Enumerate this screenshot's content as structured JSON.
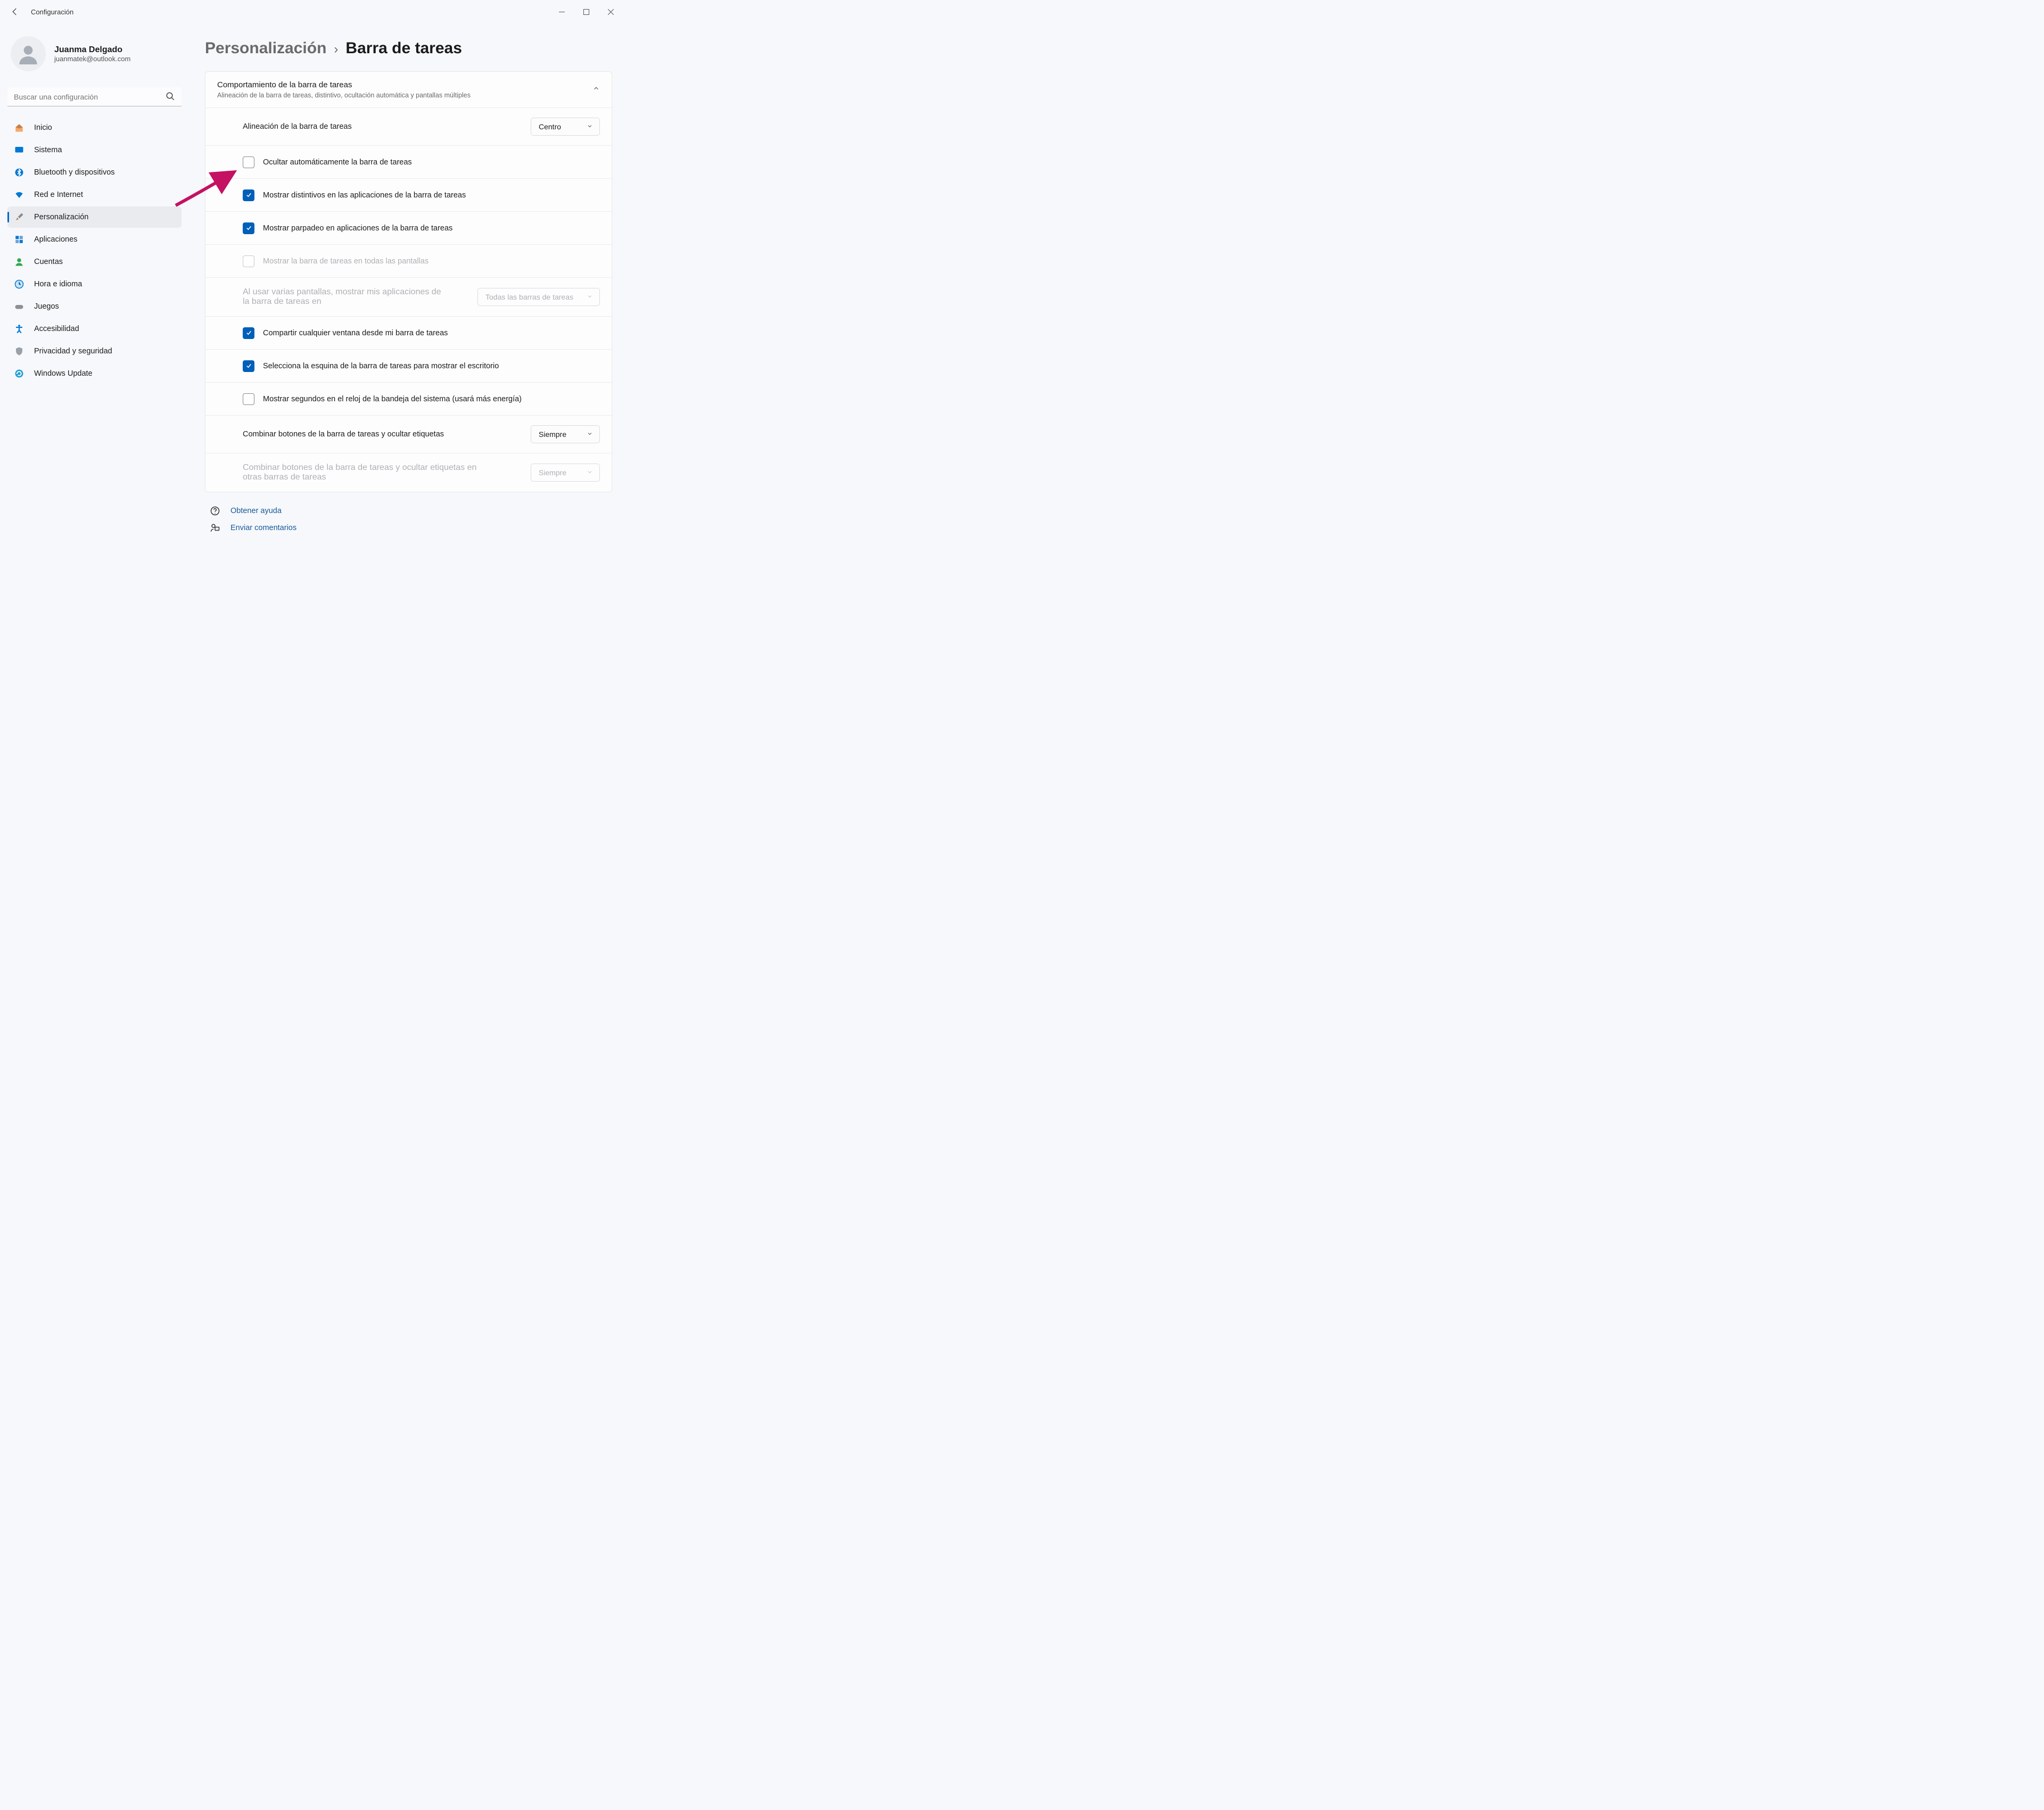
{
  "app_title": "Configuración",
  "profile": {
    "name": "Juanma Delgado",
    "email": "juanmatek@outlook.com"
  },
  "search": {
    "placeholder": "Buscar una configuración"
  },
  "nav": {
    "items": [
      {
        "label": "Inicio"
      },
      {
        "label": "Sistema"
      },
      {
        "label": "Bluetooth y dispositivos"
      },
      {
        "label": "Red e Internet"
      },
      {
        "label": "Personalización"
      },
      {
        "label": "Aplicaciones"
      },
      {
        "label": "Cuentas"
      },
      {
        "label": "Hora e idioma"
      },
      {
        "label": "Juegos"
      },
      {
        "label": "Accesibilidad"
      },
      {
        "label": "Privacidad y seguridad"
      },
      {
        "label": "Windows Update"
      }
    ],
    "selected_index": 4
  },
  "breadcrumb": {
    "parent": "Personalización",
    "sep": "›",
    "current": "Barra de tareas"
  },
  "section": {
    "title": "Comportamiento de la barra de tareas",
    "subtitle": "Alineación de la barra de tareas, distintivo, ocultación automática y pantallas múltiples",
    "alignment": {
      "label": "Alineación de la barra de tareas",
      "value": "Centro"
    },
    "opts": {
      "autohide": "Ocultar automáticamente la barra de tareas",
      "badges": "Mostrar distintivos en las aplicaciones de la barra de tareas",
      "flash": "Mostrar parpadeo en aplicaciones de la barra de tareas",
      "alldisplays": "Mostrar la barra de tareas en todas las pantallas",
      "multidisplay": {
        "label": "Al usar varias pantallas, mostrar mis aplicaciones de la barra de tareas en",
        "value": "Todas las barras de tareas"
      },
      "share": "Compartir cualquier ventana desde mi barra de tareas",
      "corner": "Selecciona la esquina de la barra de tareas para mostrar el escritorio",
      "seconds": "Mostrar segundos en el reloj de la bandeja del sistema (usará más energía)",
      "combine": {
        "label": "Combinar botones de la barra de tareas y ocultar etiquetas",
        "value": "Siempre"
      },
      "combine_other": {
        "label": "Combinar botones de la barra de tareas y ocultar etiquetas en otras barras de tareas",
        "value": "Siempre"
      }
    }
  },
  "footer": {
    "help": "Obtener ayuda",
    "feedback": "Enviar comentarios"
  }
}
